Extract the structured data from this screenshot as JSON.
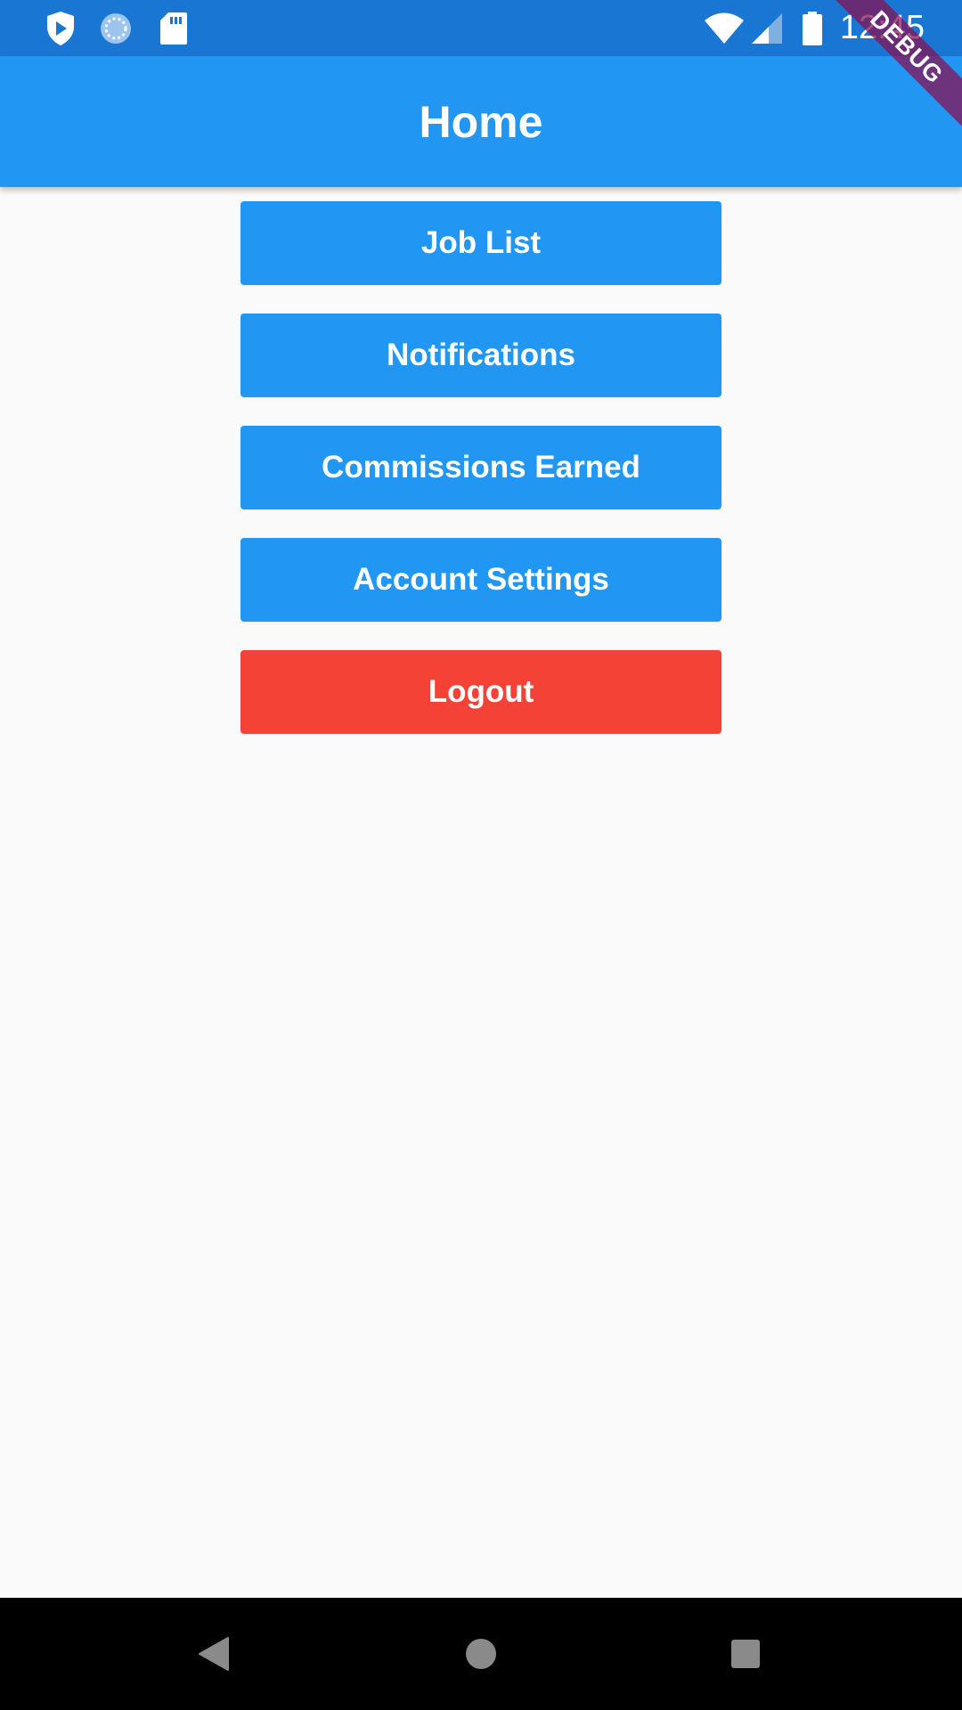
{
  "status_bar": {
    "time": "12:45",
    "left_icons": [
      "play-protect-icon",
      "sync-icon",
      "sd-card-icon"
    ],
    "right_icons": [
      "wifi-icon",
      "signal-icon",
      "battery-icon"
    ]
  },
  "debug_banner": "DEBUG",
  "app_bar": {
    "title": "Home"
  },
  "menu": {
    "buttons": [
      {
        "label": "Job List",
        "color": "#2196f3"
      },
      {
        "label": "Notifications",
        "color": "#2196f3"
      },
      {
        "label": "Commissions Earned",
        "color": "#2196f3"
      },
      {
        "label": "Account Settings",
        "color": "#2196f3"
      },
      {
        "label": "Logout",
        "color": "#f44336"
      }
    ]
  },
  "nav_bar": {
    "buttons": [
      "back-icon",
      "home-icon",
      "recents-icon"
    ]
  },
  "colors": {
    "status_bar": "#1976d2",
    "app_bar": "#2196f3",
    "primary": "#2196f3",
    "danger": "#f44336",
    "background": "#fafafa"
  }
}
